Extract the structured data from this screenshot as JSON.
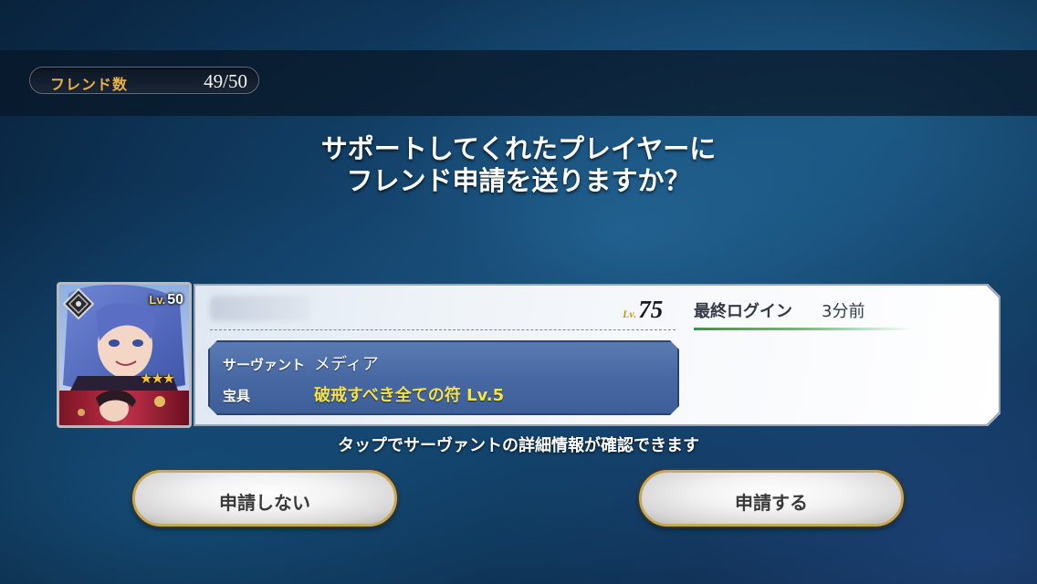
{
  "header": {
    "friend_count_label": "フレンド数",
    "friend_count_value": "49/50"
  },
  "prompt": {
    "line1": "サポートしてくれたプレイヤーに",
    "line2": "フレンド申請を送りますか？"
  },
  "support_card": {
    "servant_level_prefix": "Lv.",
    "servant_level": "50",
    "servant_rarity_stars": 3,
    "player_level_prefix": "Lv.",
    "player_level": "75",
    "last_login_label": "最終ログイン",
    "last_login_value": "3分前",
    "servant_label": "サーヴァント",
    "servant_name": "メディア",
    "np_label": "宝具",
    "np_value": "破戒すべき全ての符 Lv.5",
    "class_icon": "caster-class-icon"
  },
  "hint": "タップでサーヴァントの詳細情報が確認できます",
  "buttons": {
    "decline_label": "申請しない",
    "accept_label": "申請する"
  },
  "colors": {
    "accent_gold": "#e8b24a",
    "np_yellow": "#f5e24a",
    "servant_box_blue": "#4768a3",
    "login_green": "#2f9a4a"
  }
}
